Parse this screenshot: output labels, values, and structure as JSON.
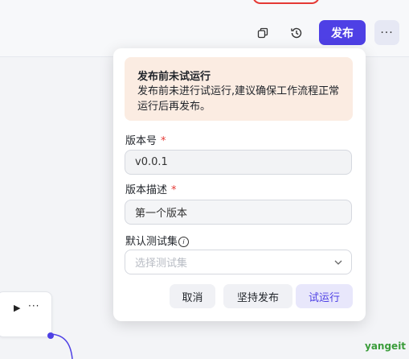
{
  "toolbar": {
    "publish_label": "发布",
    "more_label": "···",
    "icons": [
      "copy-icon",
      "history-icon"
    ]
  },
  "node": {
    "play_icon": "▶",
    "more_label": "···"
  },
  "watermark": "yangeit",
  "popover": {
    "alert": {
      "title": "发布前未试运行",
      "text": "发布前未进行试运行,建议确保工作流程正常运行后再发布。"
    },
    "version": {
      "label": "版本号",
      "required_mark": "*",
      "value": "v0.0.1"
    },
    "description": {
      "label": "版本描述",
      "required_mark": "*",
      "value": "第一个版本"
    },
    "testset": {
      "label": "默认测试集",
      "info_icon": "i",
      "placeholder": "选择测试集"
    },
    "buttons": {
      "cancel": "取消",
      "insist_publish": "坚持发布",
      "test_run": "试运行"
    }
  },
  "colors": {
    "accent": "#4e40e5",
    "alert_bg": "#fbece2",
    "required": "#e53935"
  }
}
